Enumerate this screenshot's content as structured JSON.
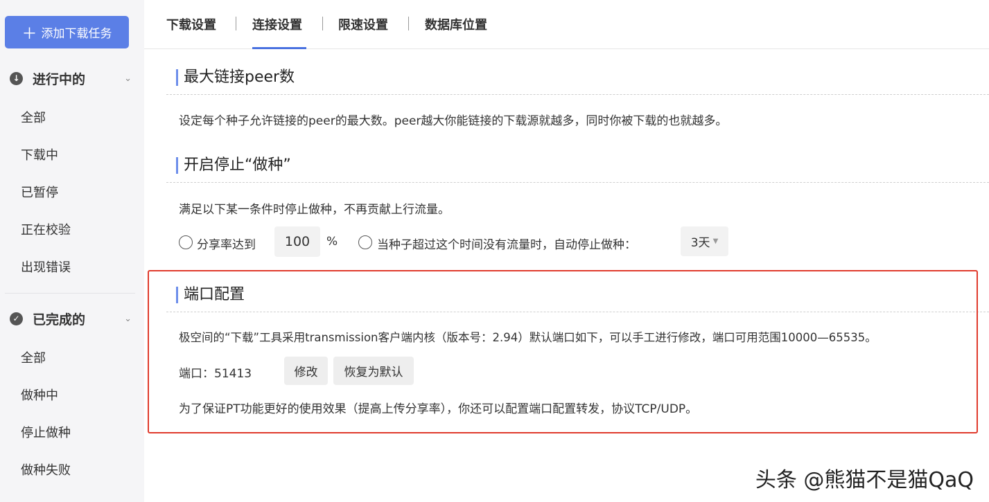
{
  "sidebar": {
    "add_button": {
      "icon": "plus-icon",
      "label": "添加下载任务"
    },
    "groups": [
      {
        "title": "进行中的",
        "icon": "download-circle-icon",
        "items": [
          "全部",
          "下载中",
          "已暂停",
          "正在校验",
          "出现错误"
        ]
      },
      {
        "title": "已完成的",
        "icon": "check-circle-icon",
        "items": [
          "全部",
          "做种中",
          "停止做种",
          "做种失败"
        ]
      }
    ]
  },
  "tabs": [
    {
      "label": "下载设置",
      "active": false
    },
    {
      "label": "连接设置",
      "active": true
    },
    {
      "label": "限速设置",
      "active": false
    },
    {
      "label": "数据库位置",
      "active": false
    }
  ],
  "sections": {
    "max_peer": {
      "title": "最大链接peer数",
      "desc": "设定每个种子允许链接的peer的最大数。peer越大你能链接的下载源就越多，同时你被下载的也就越多。"
    },
    "seeding": {
      "title": "开启停止“做种”",
      "desc": "满足以下某一条件时停止做种，不再贡献上行流量。",
      "ratio_label": "分享率达到",
      "ratio_value": "100",
      "ratio_unit": "%",
      "idle_label": "当种子超过这个时间没有流量时，自动停止做种：",
      "idle_value": "3天"
    },
    "port": {
      "title": "端口配置",
      "desc": "极空间的“下载”工具采用transmission客户端内核（版本号：2.94）默认端口如下，可以手工进行修改，端口可用范围10000—65535。",
      "port_label": "端口：51413",
      "modify_button": "修改",
      "reset_button": "恢复为默认",
      "note": "为了保证PT功能更好的使用效果（提高上传分享率），你还可以配置端口配置转发，协议TCP/UDP。"
    }
  },
  "watermark": "头条 @熊猫不是猫QaQ",
  "colors": {
    "accent": "#5b7fe6",
    "highlight": "#e03a2c"
  }
}
